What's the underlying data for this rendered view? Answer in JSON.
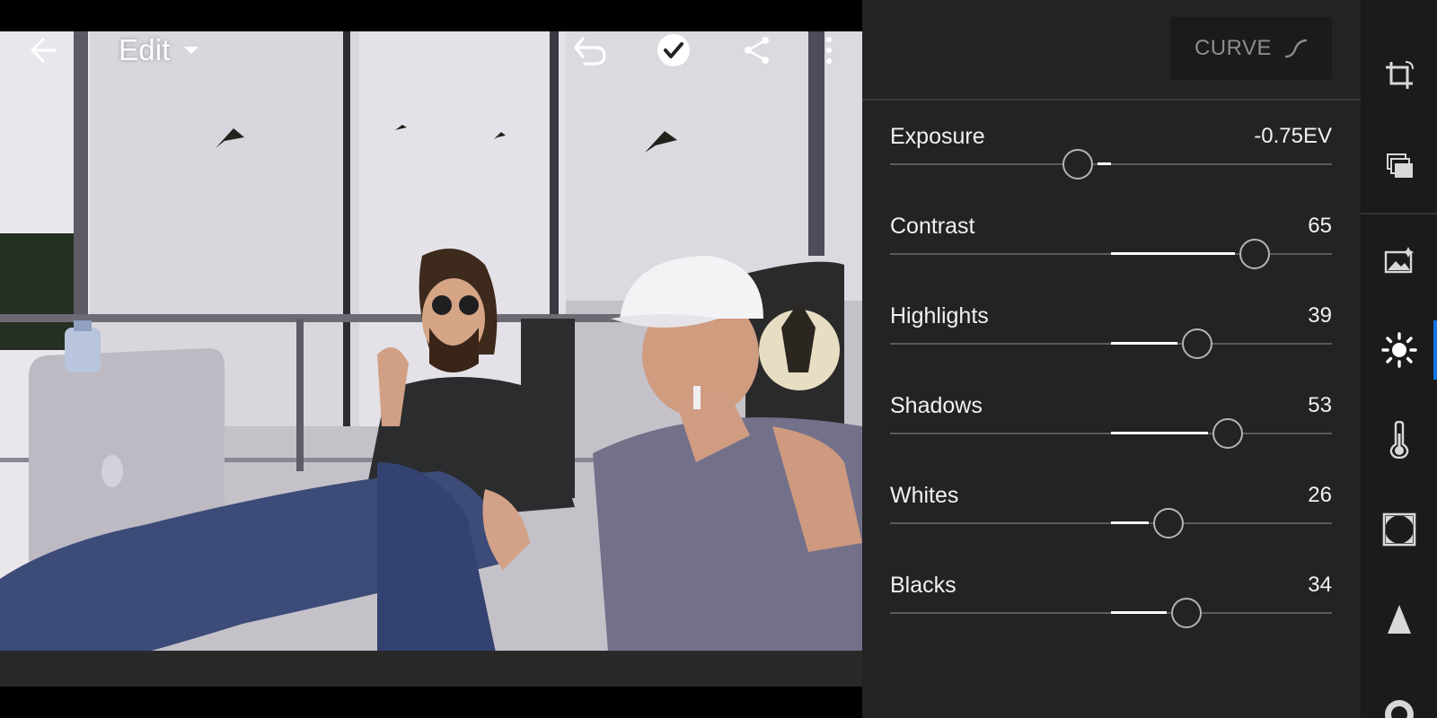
{
  "header": {
    "title": "Edit"
  },
  "panel": {
    "mode_button": "CURVE",
    "sliders": [
      {
        "name": "Exposure",
        "value": "-0.75EV",
        "level": 0.425
      },
      {
        "name": "Contrast",
        "value": "65",
        "level": 0.825
      },
      {
        "name": "Highlights",
        "value": "39",
        "level": 0.695
      },
      {
        "name": "Shadows",
        "value": "53",
        "level": 0.765
      },
      {
        "name": "Whites",
        "value": "26",
        "level": 0.63
      },
      {
        "name": "Blacks",
        "value": "34",
        "level": 0.67
      }
    ]
  },
  "toolbar": {
    "active_tool": "light-icon",
    "tools": [
      "crop-icon",
      "presets-icon",
      "auto-icon",
      "light-icon",
      "color-icon",
      "effects-icon",
      "detail-icon",
      "optics-icon"
    ]
  },
  "colors": {
    "panel_bg": "#232323",
    "toolbar_bg": "#1b1b1b",
    "accent": "#1473e6"
  }
}
